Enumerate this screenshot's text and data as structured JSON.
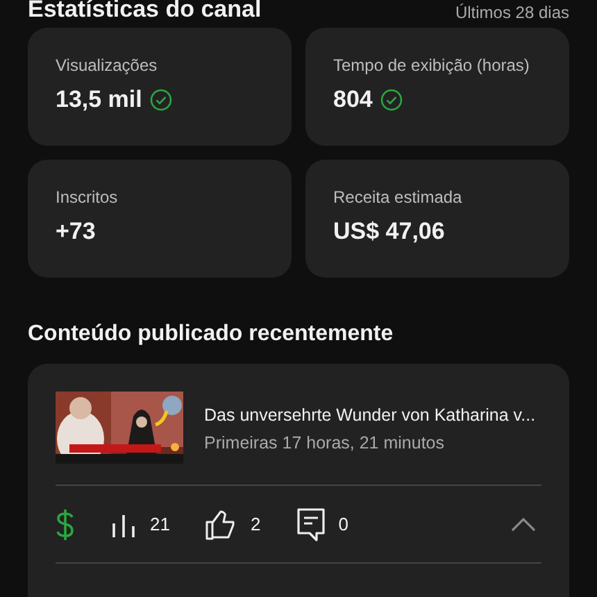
{
  "header": {
    "title": "Estatísticas do canal",
    "period": "Últimos 28 dias"
  },
  "stats": [
    {
      "label": "Visualizações",
      "value": "13,5 mil",
      "verified": true
    },
    {
      "label": "Tempo de exibição (horas)",
      "value": "804",
      "verified": true
    },
    {
      "label": "Inscritos",
      "value": "+73",
      "verified": false
    },
    {
      "label": "Receita estimada",
      "value": "US$ 47,06",
      "verified": false
    }
  ],
  "recent": {
    "title": "Conteúdo publicado recentemente",
    "videos": [
      {
        "title": "Das unversehrte Wunder von Katharina v...",
        "meta": "Primeiras 17 horas, 21 minutos",
        "monetized": true,
        "views": "21",
        "likes": "2",
        "comments": "0",
        "expanded": true
      }
    ]
  }
}
